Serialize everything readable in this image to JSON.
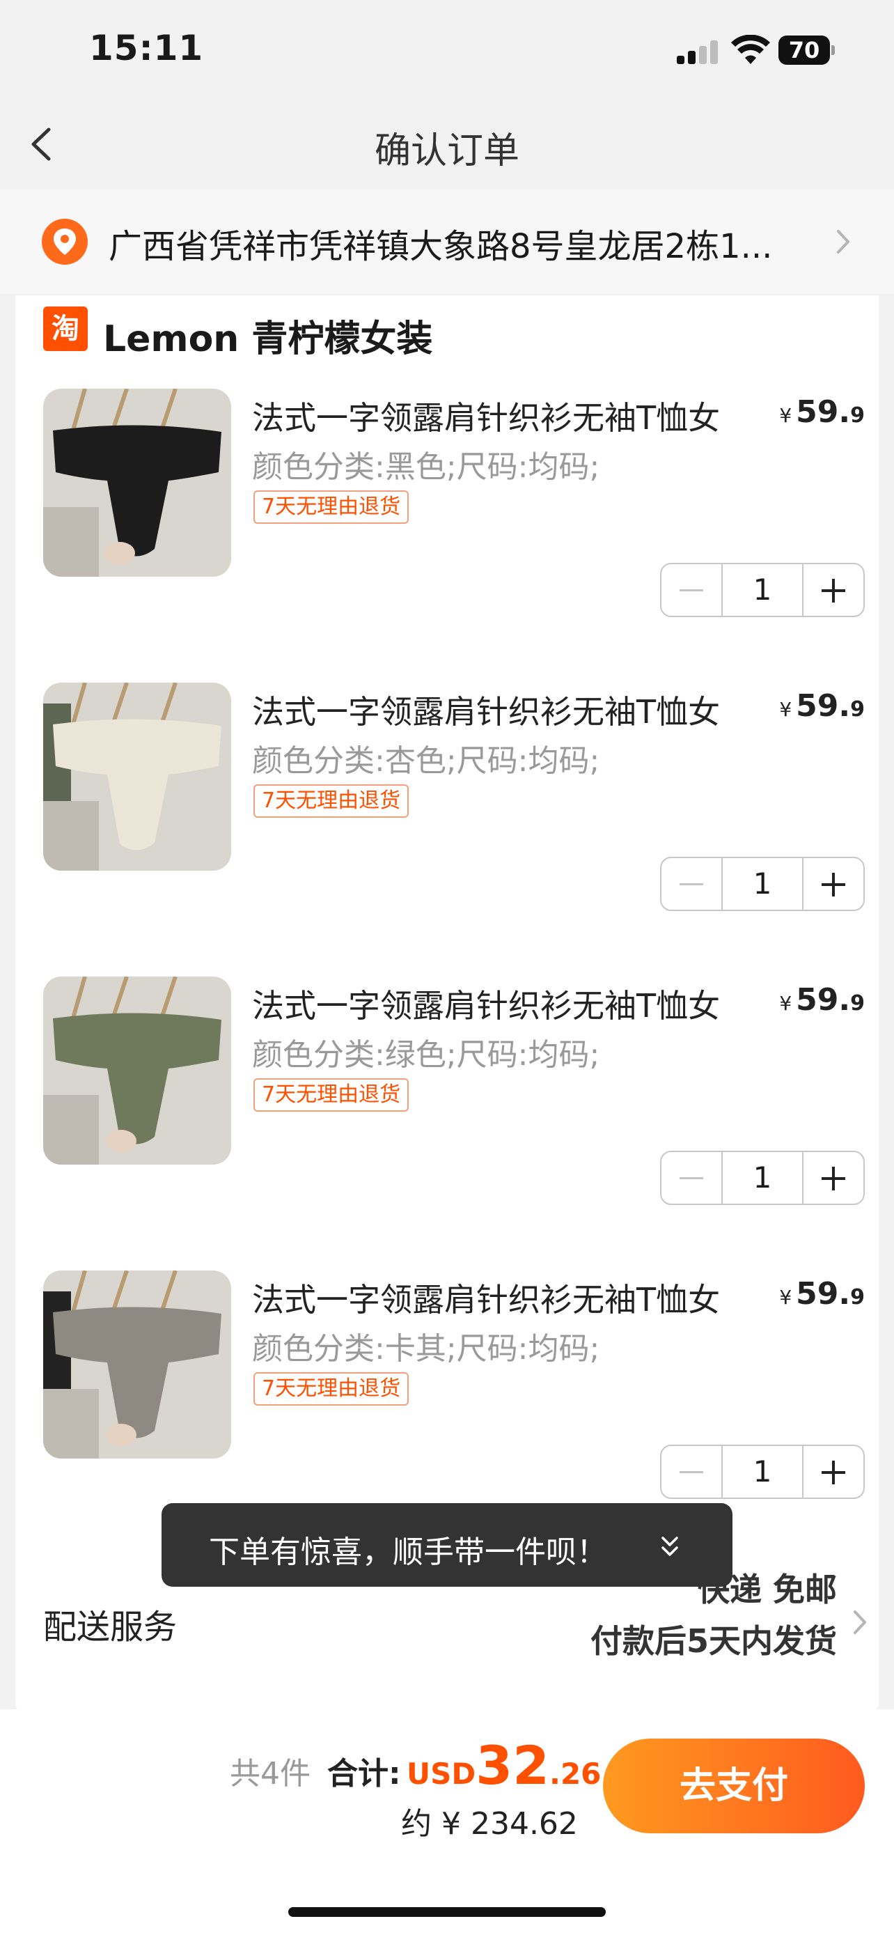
{
  "status_bar": {
    "time": "15:11",
    "battery": "70"
  },
  "nav": {
    "title": "确认订单"
  },
  "address": {
    "text": "广西省凭祥市凭祥镇大象路8号皇龙居2栋1..."
  },
  "shop": {
    "logo": "淘",
    "name": "Lemon 青柠檬女装"
  },
  "items": [
    {
      "title": "法式一字领露肩针织衫无袖T恤女",
      "price_yen": "¥",
      "price_int": "59.",
      "price_dec": "9",
      "spec": "颜色分类:黑色;尺码:均码;",
      "tag": "7天无理由退货",
      "qty": "1",
      "color": "#1c1c1c"
    },
    {
      "title": "法式一字领露肩针织衫无袖T恤女",
      "price_yen": "¥",
      "price_int": "59.",
      "price_dec": "9",
      "spec": "颜色分类:杏色;尺码:均码;",
      "tag": "7天无理由退货",
      "qty": "1",
      "color": "#ece6d8"
    },
    {
      "title": "法式一字领露肩针织衫无袖T恤女",
      "price_yen": "¥",
      "price_int": "59.",
      "price_dec": "9",
      "spec": "颜色分类:绿色;尺码:均码;",
      "tag": "7天无理由退货",
      "qty": "1",
      "color": "#6f7a5c"
    },
    {
      "title": "法式一字领露肩针织衫无袖T恤女",
      "price_yen": "¥",
      "price_int": "59.",
      "price_dec": "9",
      "spec": "颜色分类:卡其;尺码:均码;",
      "tag": "7天无理由退货",
      "qty": "1",
      "color": "#8e8a82"
    }
  ],
  "toast": {
    "text": "下单有惊喜，顺手带一件呗！"
  },
  "delivery": {
    "label": "配送服务",
    "line1": "快递 免邮",
    "line2": "付款后5天内发货"
  },
  "summary": {
    "count": "共4件",
    "total_label": "合计:",
    "currency": "USD",
    "total_int": "32",
    "total_dec": ".26",
    "approx": "约 ¥ 234.62",
    "pay_label": "去支付"
  },
  "colors": {
    "accent": "#ff5000"
  }
}
